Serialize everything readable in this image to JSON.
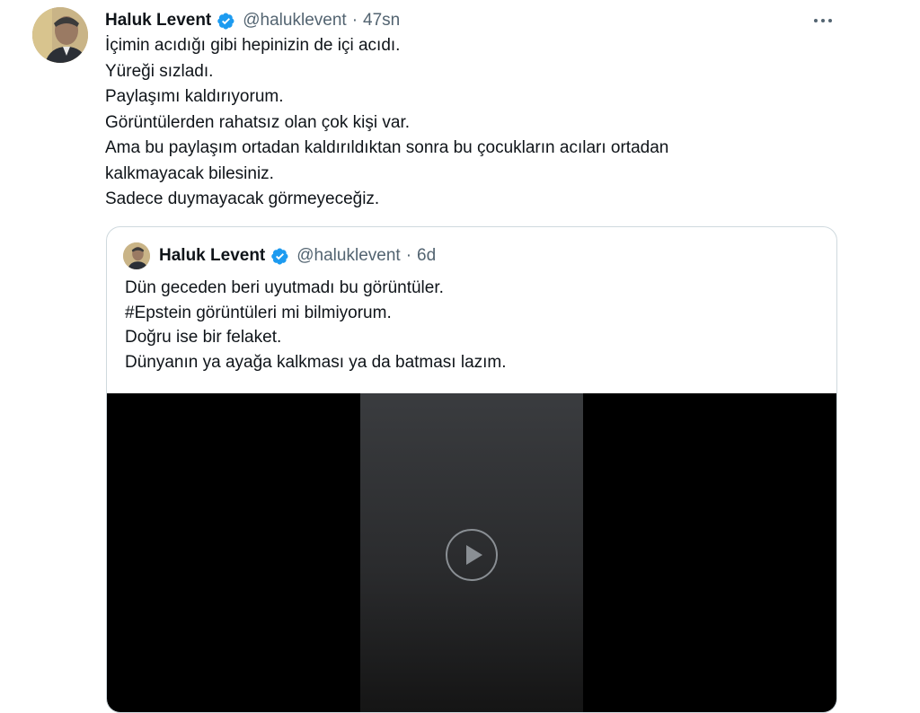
{
  "tweet": {
    "author_name": "Haluk Levent",
    "handle": "@haluklevent",
    "separator": "·",
    "time": "47sn",
    "lines": [
      "İçimin acıdığı gibi hepinizin de içi acıdı.",
      "Yüreği sızladı.",
      "Paylaşımı kaldırıyorum.",
      "Görüntülerden rahatsız olan çok kişi var.",
      "Ama bu paylaşım ortadan kaldırıldıktan sonra bu çocukların acıları ortadan",
      "kalkmayacak bilesiniz.",
      "Sadece duymayacak görmeyeceğiz."
    ]
  },
  "quoted_tweet": {
    "author_name": "Haluk Levent",
    "handle": "@haluklevent",
    "separator": "·",
    "time": "6d",
    "lines": [
      "Dün geceden beri uyutmadı bu görüntüler.",
      "#Epstein görüntüleri mi bilmiyorum.",
      "Doğru ise bir felaket.",
      "Dünyanın ya ayağa kalkması ya da batması lazım."
    ]
  },
  "icons": {
    "verified": "verified-badge-icon",
    "more": "more-options-icon",
    "media": "video-media-icon"
  },
  "colors": {
    "text": "#0f1419",
    "secondary": "#536471",
    "verified_blue": "#1d9bf0",
    "border": "#cfd9de"
  }
}
